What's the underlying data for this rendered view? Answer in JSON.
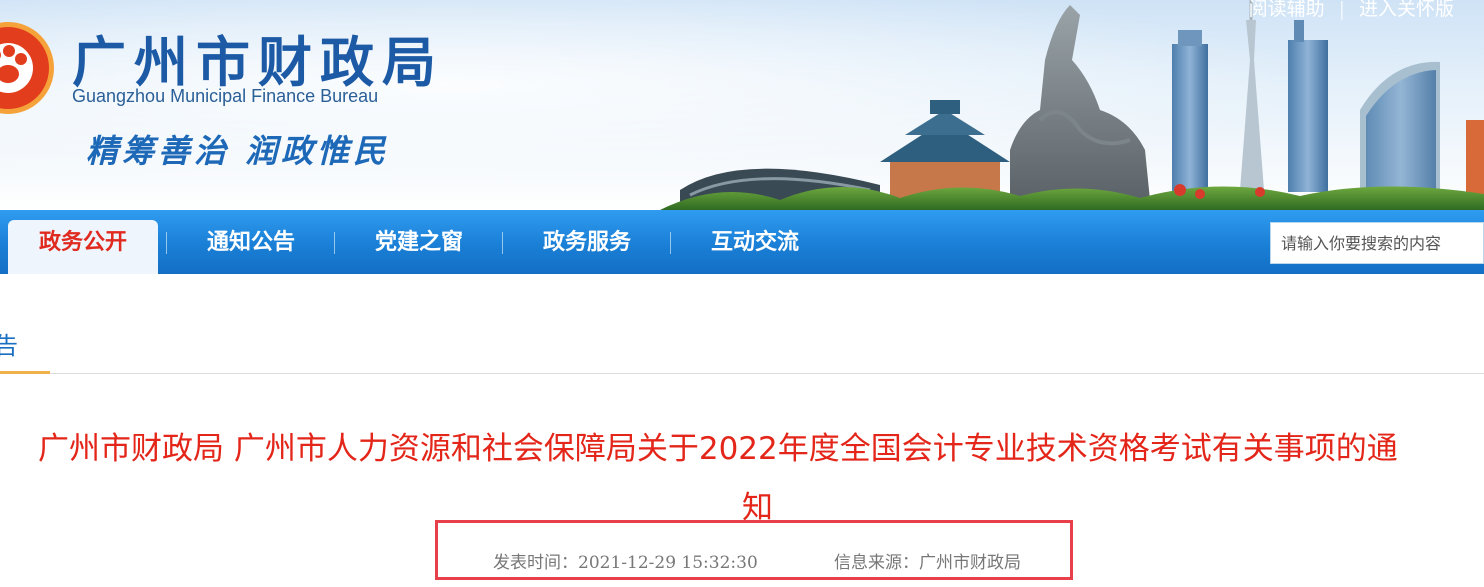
{
  "header": {
    "title_cn": "广州市财政局",
    "title_en": "Guangzhou Municipal Finance Bureau",
    "motto": "精筹善治  润政惟民",
    "top_links": [
      "阅读辅助",
      "进入关怀版"
    ]
  },
  "nav": {
    "items": [
      {
        "label": "政务公开",
        "active": true
      },
      {
        "label": "通知公告",
        "active": false
      },
      {
        "label": "党建之窗",
        "active": false
      },
      {
        "label": "政务服务",
        "active": false
      },
      {
        "label": "互动交流",
        "active": false
      }
    ]
  },
  "search": {
    "placeholder": "请输入你要搜索的内容"
  },
  "section": {
    "label": "告"
  },
  "article": {
    "title_line1": "广州市财政局 广州市人力资源和社会保障局关于2022年度全国会计专业技术资格考试有关事项的通",
    "title_line2": "知",
    "publish_time": "发表时间：2021-12-29 15:32:30",
    "source": "信息来源：广州市财政局"
  },
  "colors": {
    "nav_blue": "#1a7fd6",
    "title_red": "#e32619",
    "highlight_box": "#e8404a",
    "brand_blue": "#1c5aa6"
  }
}
